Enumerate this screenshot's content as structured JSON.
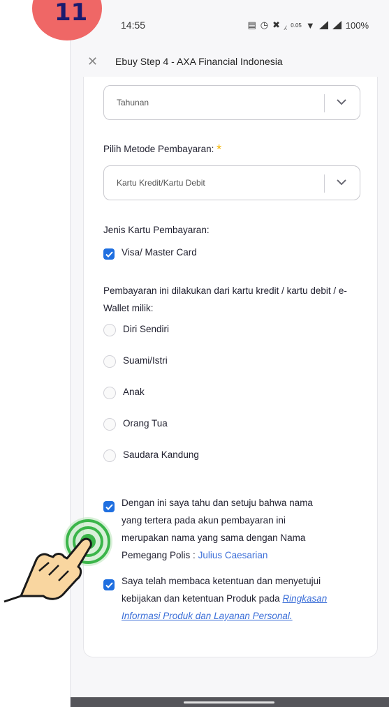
{
  "step_badge": {
    "number": "11"
  },
  "status_bar": {
    "time": "14:55",
    "battery": "100%",
    "net_speed": "0.05"
  },
  "title_bar": {
    "title": "Ebuy Step 4 - AXA Financial Indonesia"
  },
  "form": {
    "frequency_select": {
      "value": "Tahunan"
    },
    "payment_method": {
      "label": "Pilih Metode Pembayaran:",
      "required_mark": "*",
      "value": "Kartu Kredit/Kartu Debit"
    },
    "card_type": {
      "label": "Jenis Kartu Pembayaran:",
      "option": "Visa/ Master Card",
      "checked": true
    },
    "owner_question": "Pembayaran ini dilakukan dari kartu kredit / kartu debit / e-Wallet milik:",
    "owner_options": [
      "Diri Sendiri",
      "Suami/Istri",
      "Anak",
      "Orang Tua",
      "Saudara Kandung"
    ],
    "agreement_name": {
      "text_lines": [
        "Dengan ini saya tahu dan setuju bahwa nama",
        "yang tertera pada akun pembayaran ini",
        "merupakan nama yang sama dengan Nama"
      ],
      "last_line_prefix": "Pemegang Polis : ",
      "holder_name": "Julius Caesarian",
      "checked": true
    },
    "agreement_terms": {
      "line1": "Saya telah membaca ketentuan dan menyetujui",
      "line2_prefix": "kebijakan dan ketentuan Produk pada ",
      "link_part1": "Ringkasan",
      "link_part2": "Informasi Produk dan Layanan Personal.",
      "checked": true
    }
  },
  "colors": {
    "accent": "#1f6fe0",
    "link": "#3c6fd8",
    "star": "#f4b400",
    "badge": "#ef6766",
    "hint_ring": "#3bb54a"
  }
}
